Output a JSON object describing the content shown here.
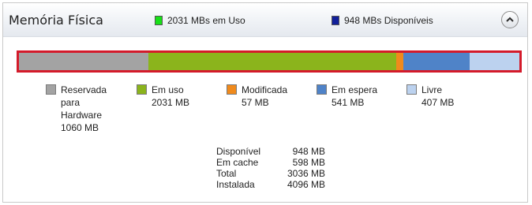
{
  "colors": {
    "reserved": "#a3a3a3",
    "in_use": "#8bb41c",
    "modified": "#f08a1c",
    "standby": "#4f83c8",
    "free": "#bcd2ef",
    "highlight_border": "#d41a2a",
    "header_in_use_swatch": "#18e018",
    "header_available_swatch": "#12209a"
  },
  "header": {
    "title": "Memória Física",
    "in_use": "2031 MBs em Uso",
    "available": "948 MBs Disponíveis",
    "collapse_icon": "chevron-up-icon"
  },
  "memory_bar": {
    "segments": [
      {
        "key": "reserved",
        "mb": 1060
      },
      {
        "key": "in_use",
        "mb": 2031
      },
      {
        "key": "modified",
        "mb": 57
      },
      {
        "key": "standby",
        "mb": 541
      },
      {
        "key": "free",
        "mb": 407
      }
    ]
  },
  "legend": [
    {
      "key": "reserved",
      "label": "Reservada para Hardware",
      "value": "1060 MB"
    },
    {
      "key": "in_use",
      "label": "Em uso",
      "value": "2031 MB"
    },
    {
      "key": "modified",
      "label": "Modificada",
      "value": "57 MB"
    },
    {
      "key": "standby",
      "label": "Em espera",
      "value": "541 MB"
    },
    {
      "key": "free",
      "label": "Livre",
      "value": "407 MB"
    }
  ],
  "stats": [
    {
      "label": "Disponível",
      "value": "948 MB"
    },
    {
      "label": "Em cache",
      "value": "598 MB"
    },
    {
      "label": "Total",
      "value": "3036 MB"
    },
    {
      "label": "Instalada",
      "value": "4096 MB"
    }
  ]
}
